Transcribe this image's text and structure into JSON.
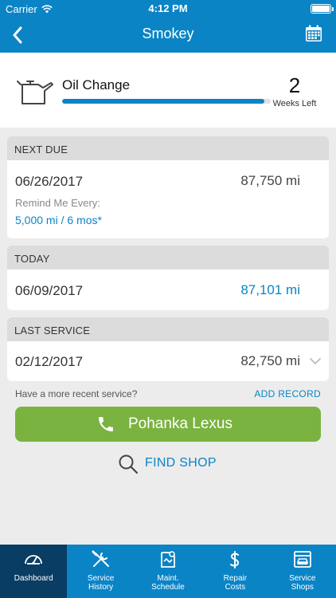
{
  "status_bar": {
    "carrier": "Carrier",
    "time": "4:12 PM"
  },
  "nav": {
    "title": "Smokey",
    "back_icon": "chevron-left-icon",
    "calendar_icon": "calendar-icon"
  },
  "service": {
    "name": "Oil Change",
    "weeks_left": "2",
    "weeks_left_label": "Weeks Left",
    "progress_fraction": 0.97,
    "icon": "oil-can-icon"
  },
  "next_due": {
    "header": "NEXT DUE",
    "date": "06/26/2017",
    "mileage": "87,750 mi",
    "remind_label": "Remind Me Every:",
    "remind_value": "5,000 mi / 6 mos*"
  },
  "today": {
    "header": "TODAY",
    "date": "06/09/2017",
    "mileage": "87,101 mi"
  },
  "last_service": {
    "header": "LAST SERVICE",
    "date": "02/12/2017",
    "mileage": "82,750 mi"
  },
  "actions": {
    "recent_question": "Have a more recent service?",
    "add_record": "ADD RECORD",
    "call_label": "Pohanka Lexus",
    "find_shop": "FIND SHOP"
  },
  "tabs": [
    {
      "line1": "Dashboard",
      "line2": "",
      "icon": "gauge-icon",
      "active": true
    },
    {
      "line1": "Service",
      "line2": "History",
      "icon": "wrench-screwdriver-icon",
      "active": false
    },
    {
      "line1": "Maint.",
      "line2": "Schedule",
      "icon": "schedule-icon",
      "active": false
    },
    {
      "line1": "Repair",
      "line2": "Costs",
      "icon": "dollar-icon",
      "active": false
    },
    {
      "line1": "Service",
      "line2": "Shops",
      "icon": "shop-icon",
      "active": false
    }
  ],
  "colors": {
    "brand_blue": "#0b84c6",
    "tab_active": "#0a3d63",
    "call_green": "#7ab340",
    "background": "#ececec"
  }
}
